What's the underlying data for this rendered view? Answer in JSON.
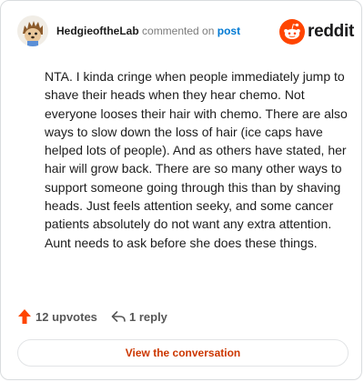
{
  "comment": {
    "username": "HedgieoftheLab",
    "action_text": "commented on",
    "target_link": "post",
    "body": "NTA. I kinda cringe when people immediately jump to shave their heads when they hear chemo. Not everyone looses their hair with chemo. There are also ways to slow down the loss of hair (ice caps have helped lots of people). And as others have stated, her hair will grow back. There are so many other ways to support someone going through this than by shaving heads. Just feels attention seeky, and some cancer patients absolutely do not want any extra attention. Aunt needs to ask before she does these things."
  },
  "brand": {
    "name": "reddit",
    "icon": "reddit-logo-icon",
    "color": "#ff4500"
  },
  "actions": {
    "upvotes_label": "12 upvotes",
    "upvote_icon": "upvote-arrow-icon",
    "replies_label": "1 reply",
    "reply_icon": "reply-arrow-icon"
  },
  "button": {
    "label": "View the conversation",
    "color": "#cc3700"
  }
}
